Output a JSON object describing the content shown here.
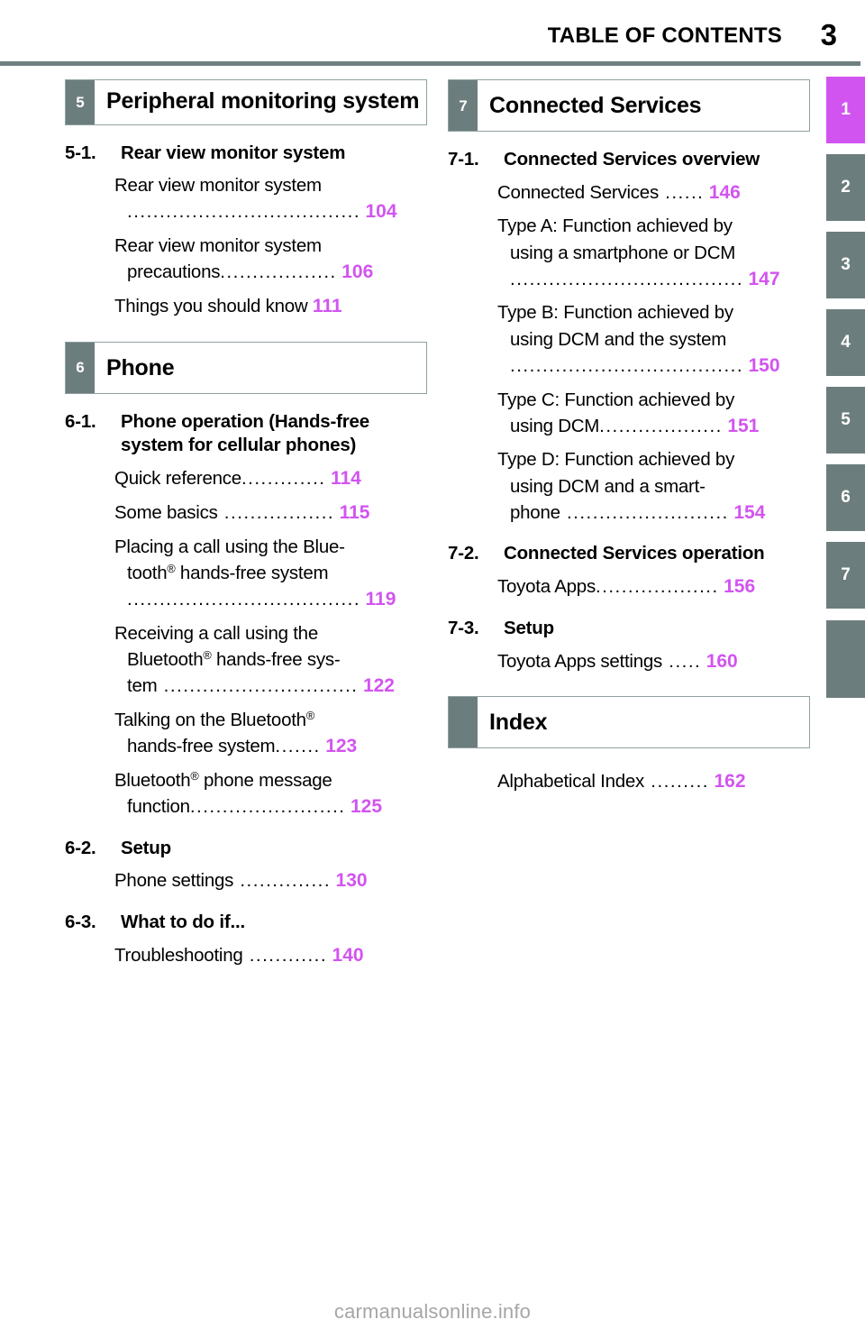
{
  "header": {
    "toc_title": "TABLE OF CONTENTS",
    "page_number": "3"
  },
  "tab_strip": {
    "tabs": [
      "1",
      "2",
      "3",
      "4",
      "5",
      "6",
      "7"
    ],
    "active": "1",
    "blank_tab_label": ""
  },
  "accent_colors": {
    "page_number_purple": "#d254f0",
    "chapter_gray": "#6c7d7d",
    "rule_gray": "#6f8082",
    "box_border": "#8fa0a2"
  },
  "left_column": {
    "chapter_5": {
      "number": "5",
      "title": "Peripheral monitoring system"
    },
    "section_5_1": {
      "number": "5-1.",
      "title": "Rear view monitor system",
      "entries": [
        {
          "line1": "Rear view monitor system",
          "leader": "....................................",
          "page": "104"
        },
        {
          "line1": "Rear view monitor system",
          "line2": "precautions",
          "leader": "..................",
          "page": "106"
        },
        {
          "line1": "Things you should know",
          "leader": " ",
          "page": "111"
        }
      ]
    },
    "chapter_6": {
      "number": "6",
      "title": "Phone"
    },
    "section_6_1": {
      "number": "6-1.",
      "title": "Phone operation (Hands-free system for cellular phones)",
      "entries": [
        {
          "line1": "Quick reference",
          "leader": ".............",
          "page": "114"
        },
        {
          "line1": "Some basics",
          "leader": " .................",
          "page": "115"
        },
        {
          "line1": "Placing a call using the Blue-",
          "line2": "tooth® hands-free system",
          "leader": "....................................",
          "page": "119"
        },
        {
          "line1": "Receiving a call using the",
          "line2": "Bluetooth® hands-free sys-",
          "line3": "tem",
          "leader": " ..............................",
          "page": "122"
        },
        {
          "line1": "Talking on the Bluetooth®",
          "line2": "hands-free system",
          "leader": ".......",
          "page": "123"
        },
        {
          "line1": "Bluetooth® phone message",
          "line2": "function",
          "leader": "........................",
          "page": "125"
        }
      ]
    },
    "section_6_2": {
      "number": "6-2.",
      "title": "Setup",
      "entries": [
        {
          "line1": "Phone settings",
          "leader": " ..............",
          "page": "130"
        }
      ]
    },
    "section_6_3": {
      "number": "6-3.",
      "title": "What to do if...",
      "entries": [
        {
          "line1": "Troubleshooting",
          "leader": " ............",
          "page": "140"
        }
      ]
    }
  },
  "right_column": {
    "chapter_7": {
      "number": "7",
      "title": "Connected Services"
    },
    "section_7_1": {
      "number": "7-1.",
      "title": "Connected Services overview",
      "entries": [
        {
          "line1": "Connected Services",
          "leader": " ......",
          "page": "146"
        },
        {
          "line1": "Type A: Function achieved by",
          "line2": "using a smartphone or DCM",
          "leader": "....................................",
          "page": "147"
        },
        {
          "line1": "Type B: Function achieved by",
          "line2": "using DCM and the system",
          "leader": "....................................",
          "page": "150"
        },
        {
          "line1": "Type C: Function achieved by",
          "line2": "using DCM",
          "leader": "...................",
          "page": "151"
        },
        {
          "line1": "Type D: Function achieved by",
          "line2": "using DCM and a smart-",
          "line3": "phone",
          "leader": " .........................",
          "page": "154"
        }
      ]
    },
    "section_7_2": {
      "number": "7-2.",
      "title": "Connected Services operation",
      "entries": [
        {
          "line1": "Toyota Apps",
          "leader": "...................",
          "page": "156"
        }
      ]
    },
    "section_7_3": {
      "number": "7-3.",
      "title": "Setup",
      "entries": [
        {
          "line1": "Toyota Apps settings",
          "leader": " .....",
          "page": "160"
        }
      ]
    },
    "index_box": {
      "number": "",
      "title": "Index"
    },
    "index_entries": [
      {
        "line1": "Alphabetical Index",
        "leader": " .........",
        "page": "162"
      }
    ]
  },
  "watermark": "carmanualsonline.info"
}
